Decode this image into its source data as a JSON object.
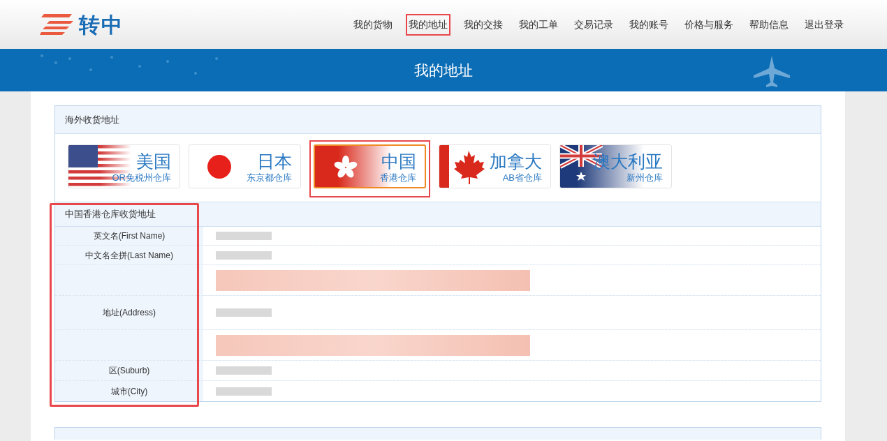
{
  "logo": {
    "text": "转中"
  },
  "nav": [
    {
      "label": "我的货物",
      "selected": false
    },
    {
      "label": "我的地址",
      "selected": true
    },
    {
      "label": "我的交接",
      "selected": false
    },
    {
      "label": "我的工单",
      "selected": false
    },
    {
      "label": "交易记录",
      "selected": false
    },
    {
      "label": "我的账号",
      "selected": false
    },
    {
      "label": "价格与服务",
      "selected": false
    },
    {
      "label": "帮助信息",
      "selected": false
    },
    {
      "label": "退出登录",
      "selected": false
    }
  ],
  "banner": {
    "title": "我的地址"
  },
  "overseas": {
    "title": "海外收货地址",
    "warehouses": [
      {
        "kind": "us",
        "name": "美国",
        "sub": "OR免税州仓库",
        "selected": false
      },
      {
        "kind": "jp",
        "name": "日本",
        "sub": "东京都仓库",
        "selected": false
      },
      {
        "kind": "hk",
        "name": "中国",
        "sub": "香港仓库",
        "selected": true
      },
      {
        "kind": "ca",
        "name": "加拿大",
        "sub": "AB省仓库",
        "selected": false
      },
      {
        "kind": "au",
        "name": "澳大利亚",
        "sub": "新州仓库",
        "selected": false
      }
    ],
    "address": {
      "title": "中国香港仓库收货地址",
      "highlighted": true,
      "rows": [
        {
          "label": "英文名(First Name)",
          "kind": "gray"
        },
        {
          "label": "中文名全拼(Last Name)",
          "kind": "gray"
        },
        {
          "kind": "pink"
        },
        {
          "label": "地址(Address)",
          "kind": "gray"
        },
        {
          "kind": "pink"
        },
        {
          "label": "区(Suburb)",
          "kind": "gray"
        },
        {
          "label": "城市(City)",
          "kind": "gray"
        }
      ]
    }
  }
}
